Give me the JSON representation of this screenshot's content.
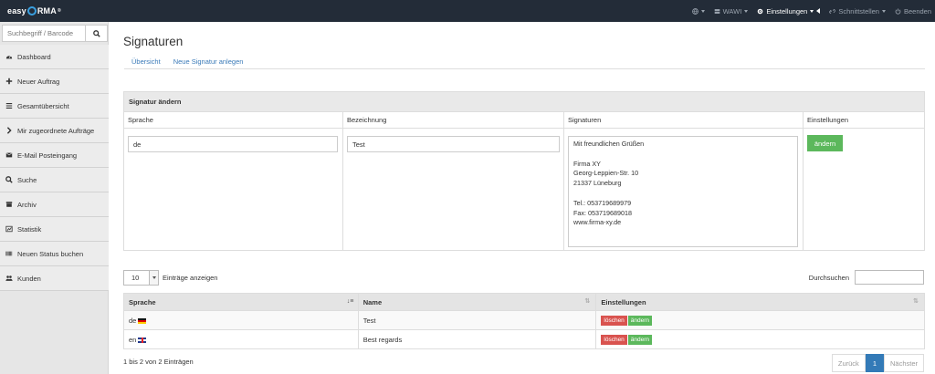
{
  "brand": {
    "pre": "easy",
    "post": "RMA",
    "mark": "®"
  },
  "topnav": {
    "wawi": "WAWI",
    "einstellungen": "Einstellungen",
    "schnittstellen": "Schnittstellen",
    "beenden": "Beenden"
  },
  "sidebar": {
    "search_placeholder": "Suchbegriff / Barcode",
    "items": [
      {
        "label": "Dashboard",
        "icon": "dashboard-icon"
      },
      {
        "label": "Neuer Auftrag",
        "icon": "plus-icon"
      },
      {
        "label": "Gesamtübersicht",
        "icon": "list-icon"
      },
      {
        "label": "Mir zugeordnete Aufträge",
        "icon": "chevron-right-icon"
      },
      {
        "label": "E-Mail Posteingang",
        "icon": "envelope-icon"
      },
      {
        "label": "Suche",
        "icon": "search-icon"
      },
      {
        "label": "Archiv",
        "icon": "archive-icon"
      },
      {
        "label": "Statistik",
        "icon": "chart-icon"
      },
      {
        "label": "Neuen Status buchen",
        "icon": "barcode-icon"
      },
      {
        "label": "Kunden",
        "icon": "users-icon"
      }
    ]
  },
  "page": {
    "title": "Signaturen",
    "tabs": [
      "Übersicht",
      "Neue Signatur anlegen"
    ]
  },
  "edit_panel": {
    "title": "Signatur ändern",
    "headers": [
      "Sprache",
      "Bezeichnung",
      "Signaturen",
      "Einstellungen"
    ],
    "sprache_value": "de",
    "bezeichnung_value": "Test",
    "signatur_text": "Mit freundlichen Grüßen\n\nFirma XY\nGeorg-Leppien-Str. 10\n21337 Lüneburg\n\nTel.: 053719689979\nFax: 053719689018\nwww.firma-xy.de",
    "save_label": "ändern"
  },
  "table": {
    "length_value": "10",
    "length_label": "Einträge anzeigen",
    "search_label": "Durchsuchen",
    "headers": [
      "Sprache",
      "Name",
      "Einstellungen"
    ],
    "rows": [
      {
        "lang": "de",
        "flag": "flag-de",
        "name": "Test",
        "delete": "löschen",
        "edit": "ändern"
      },
      {
        "lang": "en",
        "flag": "flag-gb",
        "name": "Best regards",
        "delete": "löschen",
        "edit": "ändern"
      }
    ],
    "info": "1 bis 2 von 2 Einträgen",
    "pager": {
      "prev": "Zurück",
      "current": "1",
      "next": "Nächster"
    }
  },
  "colors": {
    "topbar": "#232c38",
    "accent": "#337ab7",
    "green": "#5cb85c",
    "red": "#d9534f"
  }
}
